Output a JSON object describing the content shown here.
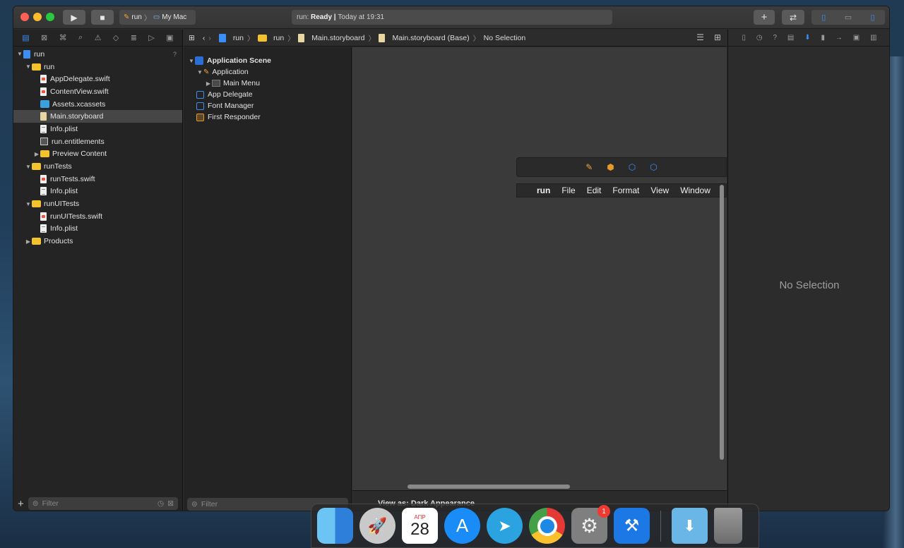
{
  "toolbar": {
    "scheme_target": "run",
    "scheme_device": "My Mac",
    "activity_prefix": "run: ",
    "activity_status": "Ready",
    "activity_sep": " | ",
    "activity_time": "Today at 19:31"
  },
  "navigator": {
    "items": [
      {
        "label": "run",
        "kind": "project",
        "level": 0,
        "expanded": true,
        "badge": "?"
      },
      {
        "label": "run",
        "kind": "folder",
        "level": 1,
        "expanded": true
      },
      {
        "label": "AppDelegate.swift",
        "kind": "swift",
        "level": 2
      },
      {
        "label": "ContentView.swift",
        "kind": "swift",
        "level": 2
      },
      {
        "label": "Assets.xcassets",
        "kind": "assets",
        "level": 2
      },
      {
        "label": "Main.storyboard",
        "kind": "storyboard",
        "level": 2,
        "selected": true
      },
      {
        "label": "Info.plist",
        "kind": "plist",
        "level": 2
      },
      {
        "label": "run.entitlements",
        "kind": "entitlements",
        "level": 2
      },
      {
        "label": "Preview Content",
        "kind": "folder",
        "level": 2,
        "expanded": false
      },
      {
        "label": "runTests",
        "kind": "folder",
        "level": 1,
        "expanded": true
      },
      {
        "label": "runTests.swift",
        "kind": "swift",
        "level": 2
      },
      {
        "label": "Info.plist",
        "kind": "plist",
        "level": 2
      },
      {
        "label": "runUITests",
        "kind": "folder",
        "level": 1,
        "expanded": true
      },
      {
        "label": "runUITests.swift",
        "kind": "swift",
        "level": 2
      },
      {
        "label": "Info.plist",
        "kind": "plist",
        "level": 2
      },
      {
        "label": "Products",
        "kind": "folder",
        "level": 1,
        "expanded": false
      }
    ],
    "filter_placeholder": "Filter"
  },
  "jumpbar": {
    "crumbs": [
      "run",
      "run",
      "Main.storyboard",
      "Main.storyboard (Base)",
      "No Selection"
    ]
  },
  "outline": {
    "scene": "Application Scene",
    "items": [
      {
        "label": "Application",
        "kind": "app",
        "level": 1,
        "expanded": true
      },
      {
        "label": "Main Menu",
        "kind": "menu",
        "level": 2,
        "expanded": false
      },
      {
        "label": "App Delegate",
        "kind": "cube",
        "level": 1
      },
      {
        "label": "Font Manager",
        "kind": "cube",
        "level": 1
      },
      {
        "label": "First Responder",
        "kind": "cube-orange",
        "level": 1
      }
    ],
    "filter_placeholder": "Filter"
  },
  "canvas": {
    "menu": [
      "run",
      "File",
      "Edit",
      "Format",
      "View",
      "Window"
    ],
    "footer_label": "View as: Dark Appearance"
  },
  "inspector": {
    "empty_label": "No Selection"
  },
  "dock": {
    "calendar_month": "АПР",
    "calendar_day": "28",
    "sysprefs_badge": "1"
  },
  "colors": {
    "accent": "#3a8ef6",
    "folder": "#f4c22b",
    "selection": "#464646"
  }
}
